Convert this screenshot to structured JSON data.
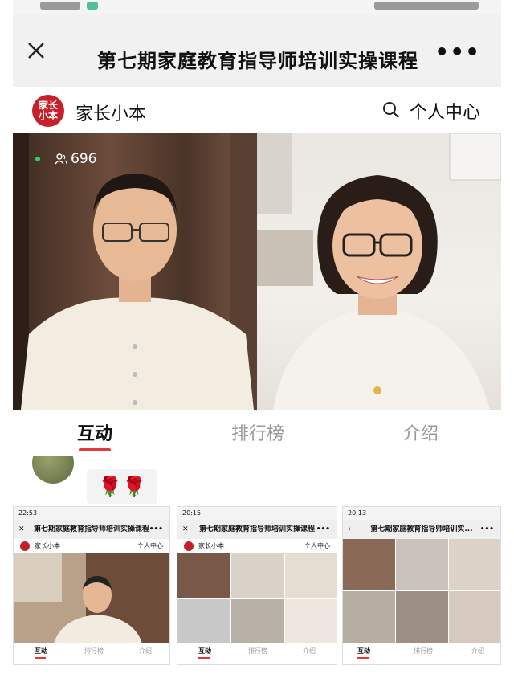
{
  "window": {
    "title": "第七期家庭教育指导师培训实操课程",
    "close_icon": "close-icon",
    "more_label": "•••"
  },
  "app": {
    "logo_text_top": "家长",
    "logo_text_bottom": "小本",
    "brand_name": "家长小本",
    "user_center": "个人中心"
  },
  "video": {
    "viewer_count": "696"
  },
  "tabs": [
    {
      "label": "互动",
      "active": true
    },
    {
      "label": "排行榜",
      "active": false
    },
    {
      "label": "介绍",
      "active": false
    }
  ],
  "chat": {
    "bubble": "🌹🌹"
  },
  "thumbnails": [
    {
      "time": "22:53",
      "title": "第七期家庭教育指导师培训实操课程",
      "brand": "家长小本",
      "user_center": "个人中心",
      "tabs": [
        "互动",
        "排行榜",
        "介绍"
      ]
    },
    {
      "time": "20:15",
      "title": "第七期家庭教育指导师培训实操课程",
      "brand": "家长小本",
      "user_center": "个人中心",
      "tabs": [
        "互动",
        "排行榜",
        "介绍"
      ]
    },
    {
      "time": "20:13",
      "title": "第七期家庭教育指导师培训实...",
      "tabs": [
        "互动",
        "排行榜",
        "介绍"
      ]
    }
  ]
}
